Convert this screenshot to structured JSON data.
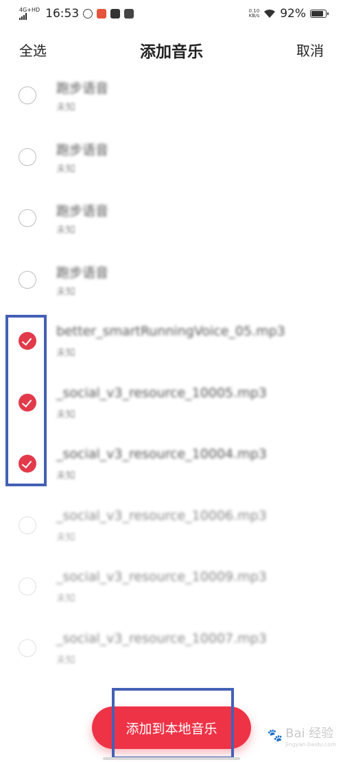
{
  "status_bar": {
    "network": "4G+HD",
    "time": "16:53",
    "speed_value": "0.10",
    "speed_unit": "KB/s",
    "battery": "92%",
    "battery_level": 0.92
  },
  "header": {
    "select_all": "全选",
    "title": "添加音乐",
    "cancel": "取消"
  },
  "items": [
    {
      "title": "跑步语音",
      "sub": "未知",
      "checked": false
    },
    {
      "title": "跑步语音",
      "sub": "未知",
      "checked": false
    },
    {
      "title": "跑步语音",
      "sub": "未知",
      "checked": false
    },
    {
      "title": "跑步语音",
      "sub": "未知",
      "checked": false
    },
    {
      "title": "better_smartRunningVoice_05.mp3",
      "sub": "未知",
      "checked": true
    },
    {
      "title": "_social_v3_resource_10005.mp3",
      "sub": "未知",
      "checked": true
    },
    {
      "title": "_social_v3_resource_10004.mp3",
      "sub": "未知",
      "checked": true
    },
    {
      "title": "_social_v3_resource_10006.mp3",
      "sub": "未知",
      "checked": false
    },
    {
      "title": "_social_v3_resource_10009.mp3",
      "sub": "未知",
      "checked": false
    },
    {
      "title": "_social_v3_resource_10007.mp3",
      "sub": "未知",
      "checked": false
    }
  ],
  "bottom": {
    "add_button": "添加到本地音乐"
  },
  "watermark": {
    "text": "Bai 经验",
    "sub": "jingyan.baidu.com"
  },
  "colors": {
    "accent": "#ee3347",
    "check": "#e23a4a",
    "annotation": "#4460b5"
  }
}
